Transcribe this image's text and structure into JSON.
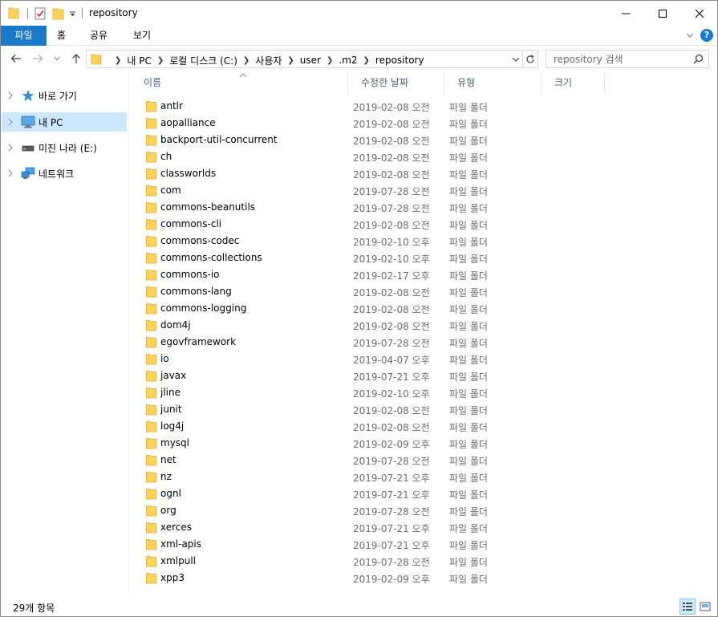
{
  "window": {
    "title": "repository"
  },
  "ribbon": {
    "tabs": [
      "파일",
      "홈",
      "공유",
      "보기"
    ]
  },
  "address": {
    "crumbs": [
      "내 PC",
      "로컬 디스크 (C:)",
      "사용자",
      "user",
      ".m2",
      "repository"
    ]
  },
  "search": {
    "placeholder": "repository 검색"
  },
  "sidebar": {
    "items": [
      {
        "label": "바로 가기",
        "icon": "star-icon"
      },
      {
        "label": "내 PC",
        "icon": "computer-icon",
        "selected": true
      },
      {
        "label": "미진 나라 (E:)",
        "icon": "drive-icon"
      },
      {
        "label": "네트워크",
        "icon": "network-icon"
      }
    ]
  },
  "columns": {
    "name": "이름",
    "modified": "수정한 날짜",
    "type": "유형",
    "size": "크기"
  },
  "files": [
    {
      "name": "antlr",
      "date": "2019-02-08 오전...",
      "type": "파일 폴더"
    },
    {
      "name": "aopalliance",
      "date": "2019-02-08 오전...",
      "type": "파일 폴더"
    },
    {
      "name": "backport-util-concurrent",
      "date": "2019-02-08 오전...",
      "type": "파일 폴더"
    },
    {
      "name": "ch",
      "date": "2019-02-08 오전...",
      "type": "파일 폴더"
    },
    {
      "name": "classworlds",
      "date": "2019-02-08 오전...",
      "type": "파일 폴더"
    },
    {
      "name": "com",
      "date": "2019-07-28 오전...",
      "type": "파일 폴더"
    },
    {
      "name": "commons-beanutils",
      "date": "2019-07-28 오전...",
      "type": "파일 폴더"
    },
    {
      "name": "commons-cli",
      "date": "2019-02-08 오전...",
      "type": "파일 폴더"
    },
    {
      "name": "commons-codec",
      "date": "2019-02-10 오후...",
      "type": "파일 폴더"
    },
    {
      "name": "commons-collections",
      "date": "2019-02-10 오후...",
      "type": "파일 폴더"
    },
    {
      "name": "commons-io",
      "date": "2019-02-17 오후...",
      "type": "파일 폴더"
    },
    {
      "name": "commons-lang",
      "date": "2019-02-08 오전...",
      "type": "파일 폴더"
    },
    {
      "name": "commons-logging",
      "date": "2019-02-08 오전...",
      "type": "파일 폴더"
    },
    {
      "name": "dom4j",
      "date": "2019-02-08 오전...",
      "type": "파일 폴더"
    },
    {
      "name": "egovframework",
      "date": "2019-07-28 오전...",
      "type": "파일 폴더"
    },
    {
      "name": "io",
      "date": "2019-04-07 오후...",
      "type": "파일 폴더"
    },
    {
      "name": "javax",
      "date": "2019-07-21 오후...",
      "type": "파일 폴더"
    },
    {
      "name": "jline",
      "date": "2019-02-10 오후...",
      "type": "파일 폴더"
    },
    {
      "name": "junit",
      "date": "2019-02-08 오전...",
      "type": "파일 폴더"
    },
    {
      "name": "log4j",
      "date": "2019-02-08 오전...",
      "type": "파일 폴더"
    },
    {
      "name": "mysql",
      "date": "2019-02-09 오후...",
      "type": "파일 폴더"
    },
    {
      "name": "net",
      "date": "2019-07-28 오전...",
      "type": "파일 폴더"
    },
    {
      "name": "nz",
      "date": "2019-07-21 오후...",
      "type": "파일 폴더"
    },
    {
      "name": "ognl",
      "date": "2019-07-21 오후...",
      "type": "파일 폴더"
    },
    {
      "name": "org",
      "date": "2019-07-28 오전...",
      "type": "파일 폴더"
    },
    {
      "name": "xerces",
      "date": "2019-07-21 오후...",
      "type": "파일 폴더"
    },
    {
      "name": "xml-apis",
      "date": "2019-07-21 오후...",
      "type": "파일 폴더"
    },
    {
      "name": "xmlpull",
      "date": "2019-07-28 오전...",
      "type": "파일 폴더"
    },
    {
      "name": "xpp3",
      "date": "2019-02-09 오후...",
      "type": "파일 폴더"
    }
  ],
  "status": {
    "count": "29개 항목"
  },
  "colors": {
    "accent": "#1979ca",
    "selection": "#cce8ff",
    "folder": "#ffd35c",
    "header_text": "#4c607a",
    "meta_text": "#6d6d6d"
  }
}
